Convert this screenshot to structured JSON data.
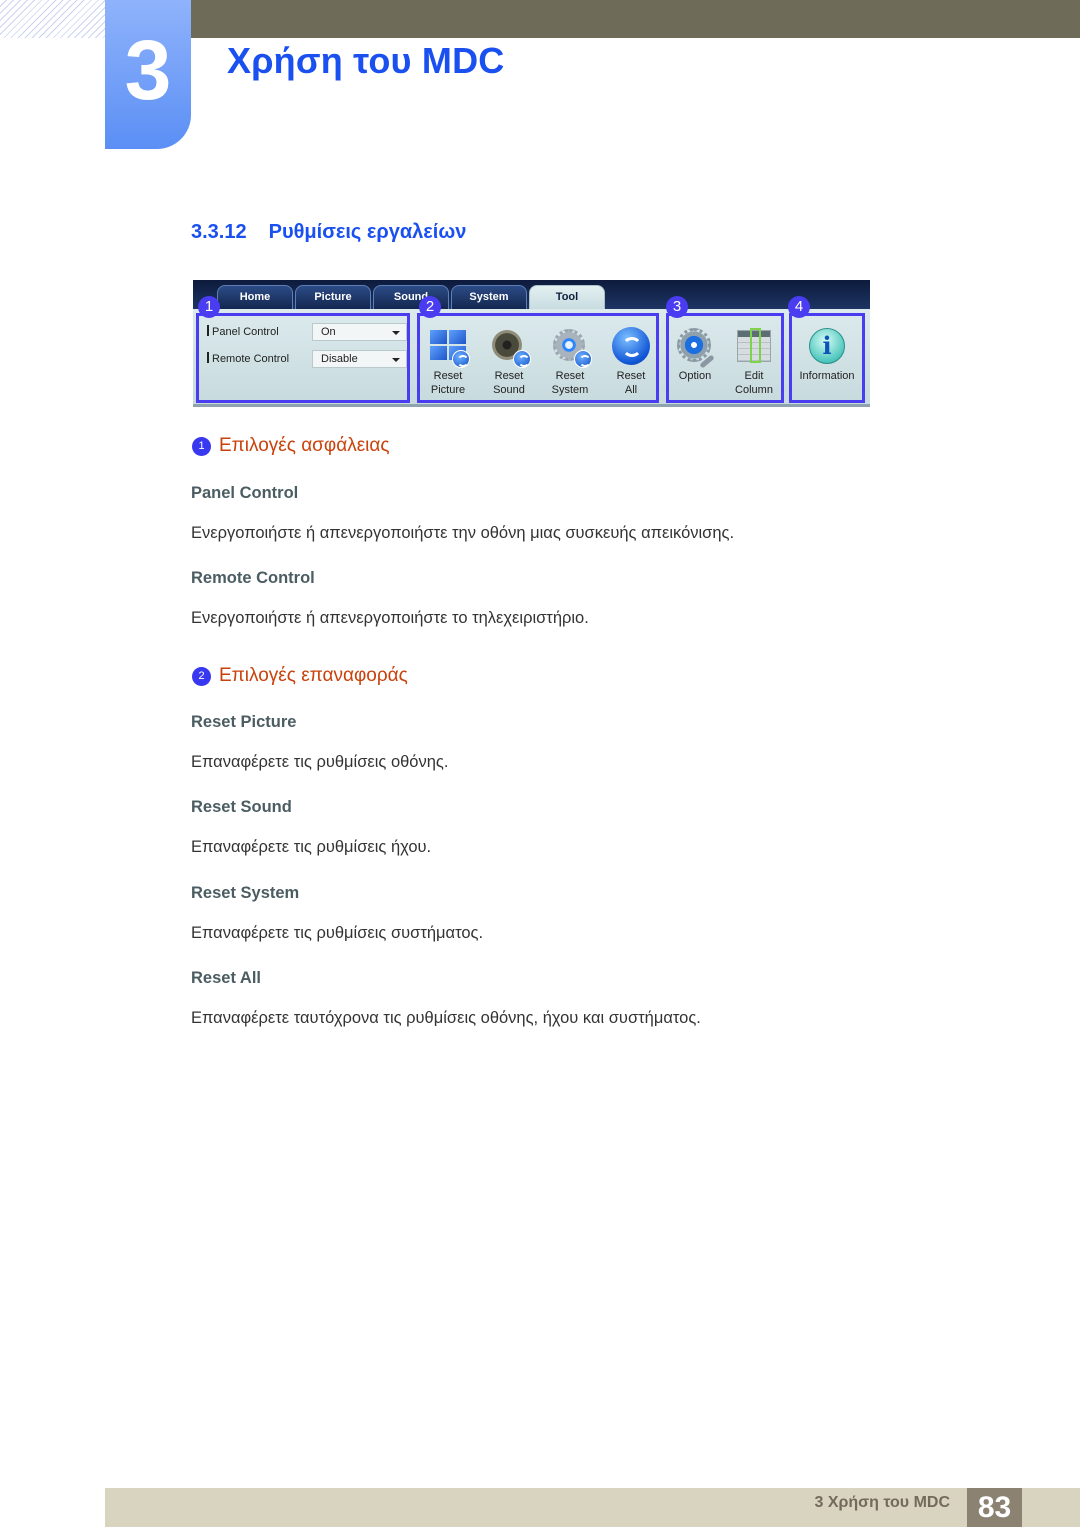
{
  "header": {
    "chapter_number": "3",
    "chapter_title": "Χρήση του MDC"
  },
  "section": {
    "number": "3.3.12",
    "title": "Ρυθμίσεις εργαλείων"
  },
  "ribbon": {
    "tabs": [
      {
        "label": "Home",
        "active": false
      },
      {
        "label": "Picture",
        "active": false
      },
      {
        "label": "Sound",
        "active": false
      },
      {
        "label": "System",
        "active": false
      },
      {
        "label": "Tool",
        "active": true
      }
    ],
    "groups": [
      {
        "badge": "1"
      },
      {
        "badge": "2"
      },
      {
        "badge": "3"
      },
      {
        "badge": "4"
      }
    ],
    "security_fields": [
      {
        "label": "Panel Control",
        "value": "On"
      },
      {
        "label": "Remote Control",
        "value": "Disable"
      }
    ],
    "buttons": [
      {
        "label": "Reset\nPicture",
        "icon": "reset-picture-icon"
      },
      {
        "label": "Reset\nSound",
        "icon": "reset-sound-icon"
      },
      {
        "label": "Reset\nSystem",
        "icon": "reset-system-icon"
      },
      {
        "label": "Reset\nAll",
        "icon": "reset-all-icon"
      },
      {
        "label": "Option",
        "icon": "option-gear-icon"
      },
      {
        "label": "Edit\nColumn",
        "icon": "edit-column-icon"
      },
      {
        "label": "Information",
        "icon": "information-icon"
      }
    ]
  },
  "content": {
    "security": {
      "badge": "1",
      "heading": "Επιλογές ασφάλειας",
      "items": [
        {
          "term": "Panel Control",
          "desc": "Ενεργοποιήστε ή απενεργοποιήστε την οθόνη μιας συσκευής απεικόνισης."
        },
        {
          "term": "Remote Control",
          "desc": "Ενεργοποιήστε ή απενεργοποιήστε το τηλεχειριστήριο."
        }
      ]
    },
    "reset": {
      "badge": "2",
      "heading": "Επιλογές επαναφοράς",
      "items": [
        {
          "term": "Reset Picture",
          "desc": "Επαναφέρετε τις ρυθμίσεις οθόνης."
        },
        {
          "term": "Reset Sound",
          "desc": "Επαναφέρετε τις ρυθμίσεις ήχου."
        },
        {
          "term": "Reset System",
          "desc": "Επαναφέρετε τις ρυθμίσεις συστήματος."
        },
        {
          "term": "Reset All",
          "desc": "Επαναφέρετε ταυτόχρονα τις ρυθμίσεις οθόνης, ήχου και συστήματος."
        }
      ]
    }
  },
  "footer": {
    "label": "3 Χρήση του MDC",
    "page_number": "83"
  },
  "colors": {
    "accent_blue": "#1a4ff0",
    "subheading_orange": "#c9420b",
    "term_gray": "#4b5d63",
    "callout_blue": "#4a3cf0"
  }
}
